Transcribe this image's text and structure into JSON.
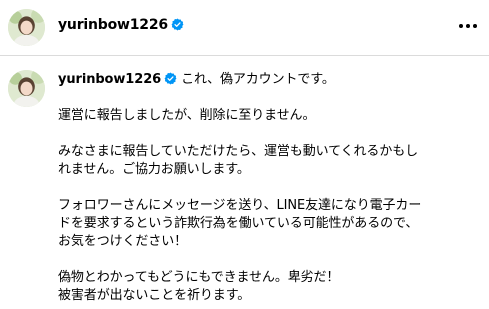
{
  "post": {
    "username": "yurinbow1226",
    "verified": true,
    "more_icon": "more-horizontal-icon"
  },
  "caption": {
    "username": "yurinbow1226",
    "first_line": "これ、偽アカウントです。",
    "paragraphs": [
      [
        "運営に報告しましたが、削除に至りません。"
      ],
      [
        "みなさまに報告していただけたら、運営も動いてくれるかもし",
        "れません。ご協力お願いします。"
      ],
      [
        "フォロワーさんにメッセージを送り、LINE友達になり電子カー",
        "ドを要求するという詐欺行為を働いている可能性があるので、",
        "お気をつけください！"
      ],
      [
        "偽物とわかってもどうにもできません。卑劣だ！",
        "被害者が出ないことを祈ります。"
      ]
    ]
  },
  "colors": {
    "verified_badge": "#0095f6",
    "divider": "#dbdbdb",
    "text": "#000000"
  }
}
